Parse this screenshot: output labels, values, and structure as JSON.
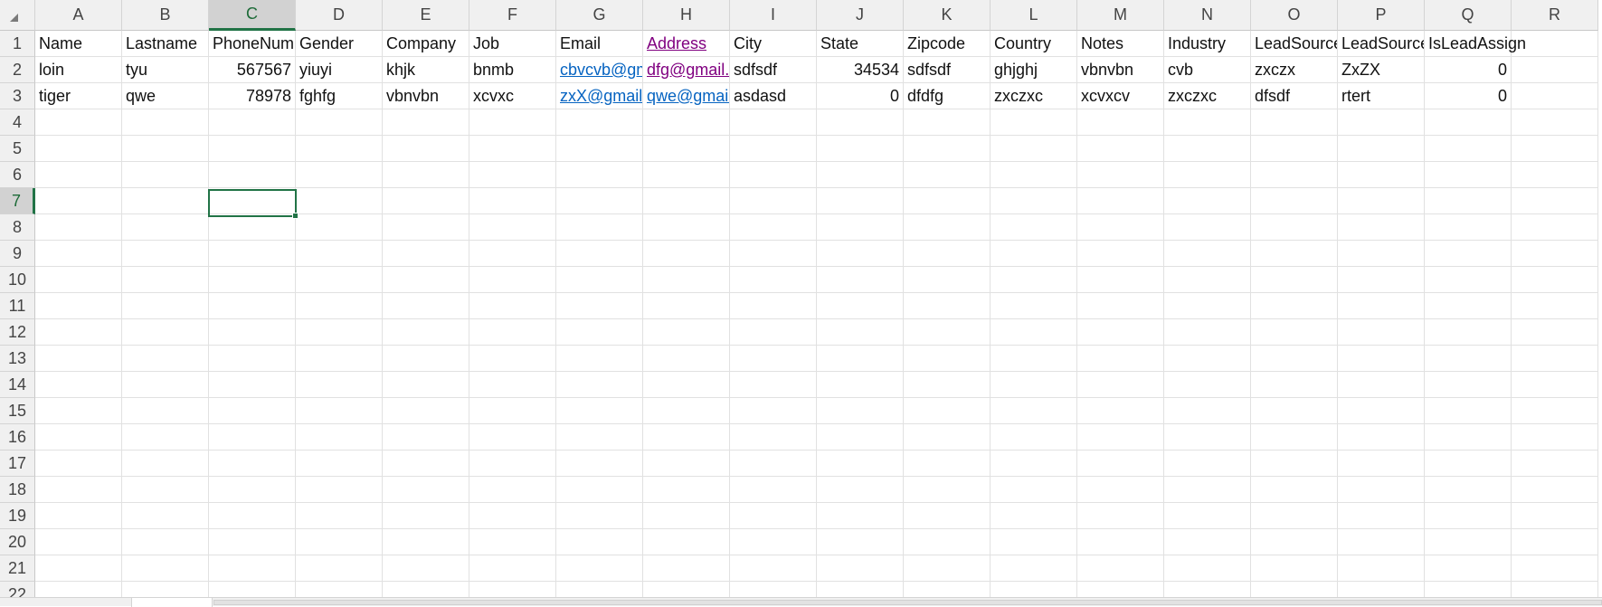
{
  "columns": [
    "A",
    "B",
    "C",
    "D",
    "E",
    "F",
    "G",
    "H",
    "I",
    "J",
    "K",
    "L",
    "M",
    "N",
    "O",
    "P",
    "Q",
    "R"
  ],
  "active_column": "C",
  "row_numbers": [
    "1",
    "2",
    "3",
    "4",
    "5",
    "6",
    "7",
    "8",
    "9",
    "10",
    "11",
    "12",
    "13",
    "14",
    "15",
    "16",
    "17",
    "18",
    "19",
    "20",
    "21",
    "22"
  ],
  "active_row": "7",
  "sheet": {
    "header_row": [
      "Name",
      "Lastname",
      "PhoneNumber",
      "Gender",
      "Company",
      "Job",
      "Email",
      "Address",
      "City",
      "State",
      "Zipcode",
      "Country",
      "Notes",
      "Industry",
      "LeadSource",
      "LeadSource",
      "IsLeadAssign",
      ""
    ],
    "data_rows": [
      [
        "loin",
        "tyu",
        "567567",
        "yiuyi",
        "khjk",
        "bnmb",
        "cbvcvb@gmail.com",
        "dfg@gmail.com",
        "sdfsdf",
        "34534",
        "sdfsdf",
        "ghjghj",
        "vbnvbn",
        "cvb",
        "zxczx",
        "ZxZX",
        "0",
        ""
      ],
      [
        "tiger",
        "qwe",
        "78978",
        "fghfg",
        "vbnvbn",
        "xcvxc",
        "zxX@gmail.com",
        "qwe@gmail.com",
        "asdasd",
        "0",
        "dfdfg",
        "zxczxc",
        "xcvxcv",
        "zxczxc",
        "dfsdf",
        "rtert",
        "0",
        ""
      ]
    ]
  },
  "selected_cell": "C7",
  "colors": {
    "header_bg": "#f0f0f0",
    "active_header_bg": "#d2d2d2",
    "selection": "#217346",
    "hyperlink": "#0563c1",
    "visited_link": "#800080"
  }
}
